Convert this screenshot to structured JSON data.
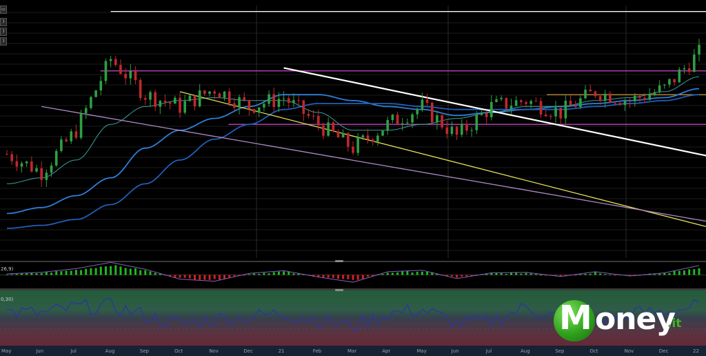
{
  "indicator_labels": {
    "macd": "26,9)",
    "oscillator": "0,30)"
  },
  "x_axis": {
    "months": [
      "May",
      "Jun",
      "Jul",
      "Aug",
      "Sep",
      "Oct",
      "Nov",
      "Dec",
      "21",
      "Feb",
      "Mar",
      "Apr",
      "May",
      "Jun",
      "Jul",
      "Aug",
      "Sep",
      "Oct",
      "Nov",
      "Dec",
      "22"
    ]
  },
  "logo": {
    "letter": "M",
    "word": "oney",
    "suffix": ".it"
  },
  "colors": {
    "up_candle": "#2ea043",
    "down_candle": "#c0282d",
    "ma_fast": "#2f7fd8",
    "ma_mid": "#1f5fb8",
    "ma_slow": "#3a6ec8",
    "ma_thin": "#3aa39a",
    "trend_white": "#ffffff",
    "trend_yellow": "#e6df5a",
    "channel_lavender": "#b08ac8",
    "level_magenta": "#d14ad1",
    "level_orange": "#e0a23a"
  },
  "chart_data": [
    {
      "type": "candlestick",
      "x": [
        "May",
        "Jun",
        "Jul",
        "Aug",
        "Sep",
        "Oct",
        "Nov",
        "Dec",
        "21",
        "Feb",
        "Mar",
        "Apr",
        "May",
        "Jun",
        "Jul",
        "Aug",
        "Sep",
        "Oct",
        "Nov",
        "Dec",
        "22"
      ],
      "close_trend": [
        50,
        44,
        58,
        82,
        70,
        66,
        72,
        66,
        69,
        60,
        52,
        60,
        66,
        56,
        66,
        68,
        64,
        71,
        68,
        72,
        84
      ],
      "moving_averages": [
        {
          "values": [
            30,
            32,
            36,
            42,
            52,
            58,
            62,
            66,
            70,
            70,
            68,
            66,
            65,
            63,
            64,
            65,
            66,
            67,
            68,
            69,
            72
          ]
        },
        {
          "values": [
            25,
            26,
            28,
            33,
            40,
            48,
            55,
            60,
            65,
            67,
            67,
            67,
            66,
            65,
            65,
            65,
            65,
            66,
            67,
            68,
            70
          ]
        },
        {
          "values": [
            40,
            42,
            48,
            60,
            66,
            68,
            69,
            68,
            68,
            64,
            58,
            58,
            60,
            62,
            64,
            66,
            66,
            68,
            69,
            71,
            76
          ]
        }
      ],
      "horizontal_levels": [
        {
          "name": "",
          "color": "#d14ad1",
          "value": 78
        },
        {
          "name": "",
          "color": "#d14ad1",
          "value": 60
        },
        {
          "name": "",
          "color": "#e0a23a",
          "value": 70
        },
        {
          "name": "",
          "color": "#ffffff",
          "value": 98
        }
      ],
      "trendlines": [
        {
          "color": "#ffffff",
          "from": [
            "21",
            79
          ],
          "to": [
            "22",
            49
          ]
        },
        {
          "color": "#e6df5a",
          "from": [
            "Oct",
            71
          ],
          "to": [
            "22",
            25
          ]
        },
        {
          "color": "#b08ac8",
          "from": [
            "Jun",
            66
          ],
          "to": [
            "22",
            27
          ]
        }
      ],
      "ylim": [
        15,
        100
      ],
      "grid": true
    },
    {
      "type": "macd_histogram",
      "series": [
        {
          "values": [
            0.2,
            0.5,
            1.2,
            2.4,
            1.1,
            -0.8,
            -1.2,
            0.3,
            0.8,
            -0.4,
            -1.4,
            0.6,
            0.9,
            -0.7,
            0.4,
            0.5,
            -0.3,
            0.6,
            -0.2,
            0.4,
            1.8
          ]
        }
      ],
      "ylim": [
        -3,
        3
      ]
    },
    {
      "type": "line",
      "series": [
        {
          "values": [
            62,
            58,
            70,
            72,
            55,
            38,
            48,
            52,
            60,
            46,
            35,
            58,
            66,
            40,
            44,
            70,
            52,
            45,
            58,
            62,
            72
          ]
        }
      ],
      "ylim": [
        0,
        100
      ]
    }
  ]
}
